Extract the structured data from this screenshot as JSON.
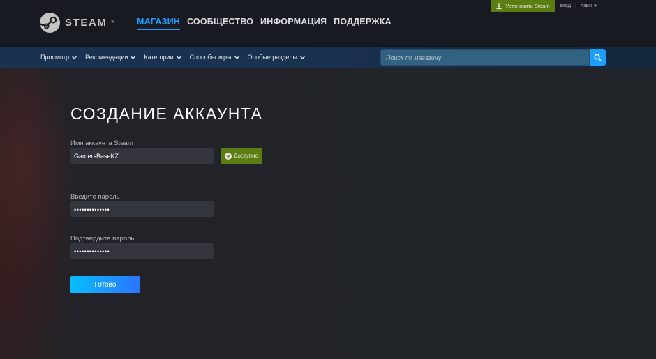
{
  "header": {
    "logo_text": "STEAM",
    "logo_mark": "®",
    "nav": [
      "МАГАЗИН",
      "СООБЩЕСТВО",
      "ИНФОРМАЦИЯ",
      "ПОДДЕРЖКА"
    ],
    "active_nav": "МАГАЗИН",
    "install_label": "Установить Steam",
    "login_label": "вход",
    "separator": "|",
    "language_label": "язык"
  },
  "store_nav": {
    "tabs": [
      "Просмотр",
      "Рекомендации",
      "Категории",
      "Способы игры",
      "Особые разделы"
    ],
    "search_placeholder": "Поиск по магазину"
  },
  "form": {
    "title": "СОЗДАНИЕ АККАУНТА",
    "account_label": "Имя аккаунта Steam",
    "account_value": "GamersBaseKZ",
    "available_label": "Доступно",
    "password_label": "Введите пароль",
    "password_value": "••••••••••••••",
    "confirm_label": "Подтвердите пароль",
    "confirm_value": "••••••••••••••",
    "submit_label": "Готово"
  },
  "colors": {
    "accent": "#1a9fff",
    "header_bg": "#171a21",
    "install_green": "#5c7e10",
    "available_green": "#5c7e10"
  }
}
